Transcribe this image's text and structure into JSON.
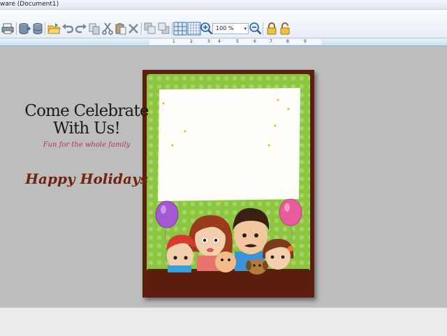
{
  "window": {
    "title": "ware  (Document1)"
  },
  "toolbar": {
    "zoom_value": "100 %",
    "zoom_arrow": "▾",
    "icons": [
      "print-icon",
      "database-export-icon",
      "database-icon",
      "open-folder-icon",
      "undo-icon",
      "redo-icon",
      "copy-icon",
      "cut-icon",
      "paste-icon",
      "delete-icon",
      "bring-forward-icon",
      "send-backward-icon",
      "grid-icon",
      "snap-grid-icon",
      "zoom-in-icon",
      "zoom-out-icon",
      "lock-icon",
      "unlock-icon"
    ]
  },
  "ruler": {
    "labels": [
      "1",
      "2",
      "3",
      "4",
      "5",
      "6",
      "7",
      "8",
      "9"
    ]
  },
  "card": {
    "heading_line1": "Come Celebrate",
    "heading_line2": "With Us!",
    "subtitle": "Fun for the whole family",
    "greeting": "Happy Holidays",
    "colors": {
      "frame": "#8cc63e",
      "border": "#5a1f0d",
      "greeting": "#6e2410",
      "subtitle": "#b0306e"
    }
  }
}
